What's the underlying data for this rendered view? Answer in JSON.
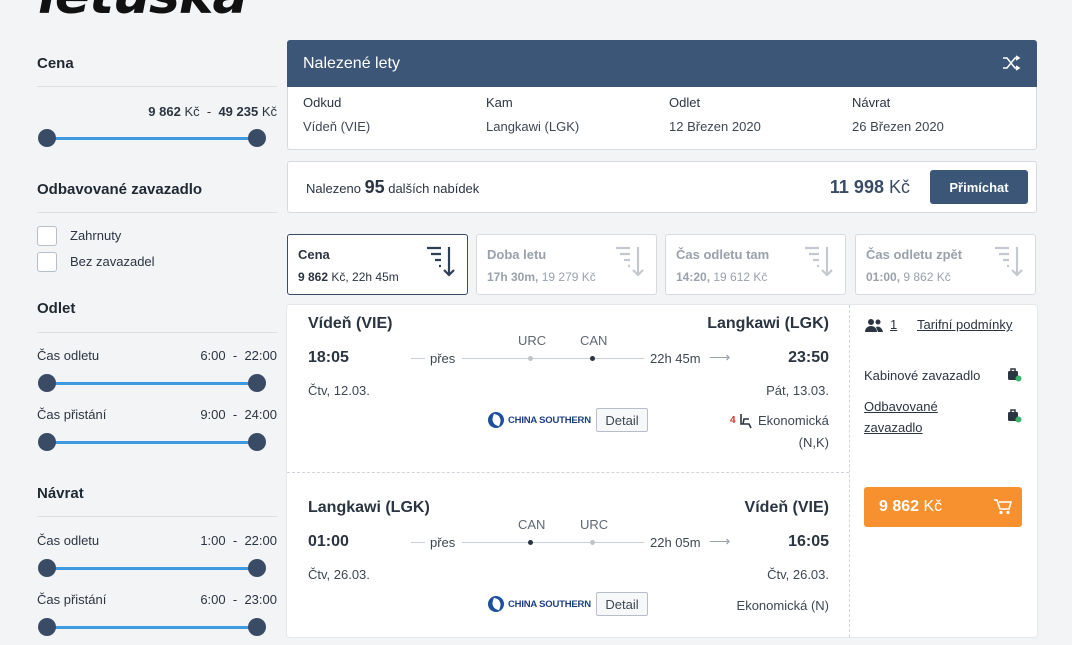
{
  "logo": "letuska",
  "sidebar": {
    "price": {
      "title": "Cena",
      "min_value": "9 862",
      "min_unit": "Kč",
      "sep": "-",
      "max_value": "49 235",
      "max_unit": "Kč"
    },
    "baggage": {
      "title": "Odbavované zavazadlo",
      "options": [
        "Zahrnuty",
        "Bez zavazadel"
      ]
    },
    "departure": {
      "title": "Odlet",
      "dep_label": "Čas odletu",
      "dep_from": "6:00",
      "dep_to": "22:00",
      "arr_label": "Čas přistání",
      "arr_from": "9:00",
      "arr_to": "24:00"
    },
    "return": {
      "title": "Návrat",
      "dep_label": "Čas odletu",
      "dep_from": "1:00",
      "dep_to": "22:00",
      "arr_label": "Čas přistání",
      "arr_from": "6:00",
      "arr_to": "23:00"
    },
    "range_sep": "-"
  },
  "header": {
    "title": "Nalezené lety",
    "shuffle_icon": "shuffle-icon"
  },
  "info": {
    "from_label": "Odkud",
    "from_value": "Vídeň (VIE)",
    "to_label": "Kam",
    "to_value": "Langkawi (LGK)",
    "depart_label": "Odlet",
    "depart_value": "12 Březen 2020",
    "return_label": "Návrat",
    "return_value": "26 Březen 2020"
  },
  "found": {
    "prefix": "Nalezeno",
    "count": "95",
    "suffix": "dalších nabídek",
    "price_value": "11 998",
    "price_unit": "Kč",
    "button": "Přimíchat"
  },
  "sort_tabs": [
    {
      "label": "Cena",
      "sub_bold": "9 862",
      "sub_rest": " Kč, 22h 45m",
      "active": true
    },
    {
      "label": "Doba letu",
      "sub_bold": "17h 30m,",
      "sub_rest": " 19 279 Kč",
      "active": false
    },
    {
      "label": "Čas odletu tam",
      "sub_bold": "14:20,",
      "sub_rest": " 19 612 Kč",
      "active": false
    },
    {
      "label": "Čas odletu zpět",
      "sub_bold": "01:00,",
      "sub_rest": " 9 862 Kč",
      "active": false
    }
  ],
  "outbound": {
    "from_city": "Vídeň (VIE)",
    "to_city": "Langkawi (LGK)",
    "dep_time": "18:05",
    "arr_time": "23:50",
    "via": "přes",
    "stop1": "URC",
    "stop2": "CAN",
    "duration": "22h 45m",
    "dep_date": "Čtv, 12.03.",
    "arr_date": "Pát, 13.03.",
    "airline": "CHINA SOUTHERN",
    "detail": "Detail",
    "seats": "4",
    "cabin_line1": "Ekonomická",
    "cabin_line2": "(N,K)"
  },
  "inbound": {
    "from_city": "Langkawi (LGK)",
    "to_city": "Vídeň (VIE)",
    "dep_time": "01:00",
    "arr_time": "16:05",
    "via": "přes",
    "stop1": "CAN",
    "stop2": "URC",
    "duration": "22h 05m",
    "dep_date": "Čtv, 26.03.",
    "arr_date": "Čtv, 26.03.",
    "airline": "CHINA SOUTHERN",
    "detail": "Detail",
    "cabin": "Ekonomická (N)"
  },
  "right_panel": {
    "passengers": "1",
    "tariff": "Tarifní podmínky",
    "cabin_bag": "Kabinové zavazadlo",
    "checked_bag_line1": "Odbavované",
    "checked_bag_line2": "zavazadlo",
    "buy_value": "9 862",
    "buy_unit": "Kč"
  },
  "colors": {
    "header": "#3c5678",
    "accent": "#f7912f",
    "slider": "#3f9ae0",
    "knob": "#3a4b66"
  }
}
